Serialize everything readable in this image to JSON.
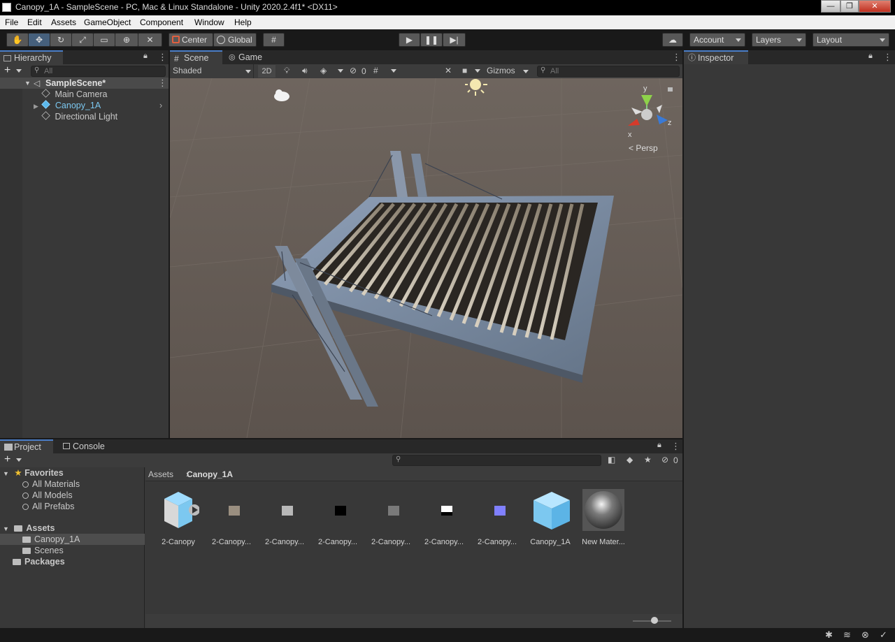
{
  "window": {
    "title": "Canopy_1A - SampleScene - PC, Mac & Linux Standalone - Unity 2020.2.4f1* <DX11>",
    "buttons": [
      "—",
      "❐",
      "✕"
    ]
  },
  "menu": [
    "File",
    "Edit",
    "Assets",
    "GameObject",
    "Component",
    "Window",
    "Help"
  ],
  "toolbar": {
    "pivot": "Center",
    "space": "Global",
    "account": "Account",
    "layers": "Layers",
    "layout": "Layout"
  },
  "hierarchy": {
    "tab": "Hierarchy",
    "search_placeholder": "All",
    "scene": "SampleScene*",
    "items": [
      "Main Camera",
      "Canopy_1A",
      "Directional Light"
    ]
  },
  "scene": {
    "tabs": [
      "Scene",
      "Game"
    ],
    "shading": "Shaded",
    "mode_2d": "2D",
    "hidden_count": "0",
    "gizmos": "Gizmos",
    "search_placeholder": "All",
    "persp": "Persp",
    "axis": {
      "x": "x",
      "y": "y",
      "z": "z"
    }
  },
  "inspector": {
    "tab": "Inspector"
  },
  "project": {
    "tabs": [
      "Project",
      "Console"
    ],
    "favorites": {
      "label": "Favorites",
      "items": [
        "All Materials",
        "All Models",
        "All Prefabs"
      ]
    },
    "assets": {
      "label": "Assets",
      "items": [
        "Canopy_1A",
        "Scenes"
      ]
    },
    "packages": "Packages",
    "breadcrumb": [
      "Assets",
      "Canopy_1A"
    ],
    "hidden_count": "0",
    "grid": [
      "2-Canopy",
      "2-Canopy...",
      "2-Canopy...",
      "2-Canopy...",
      "2-Canopy...",
      "2-Canopy...",
      "2-Canopy...",
      "Canopy_1A",
      "New Mater..."
    ]
  },
  "colors": {
    "selection": "#4a7ec8",
    "prefab_blue": "#7cc8f0",
    "panel": "#383838"
  }
}
